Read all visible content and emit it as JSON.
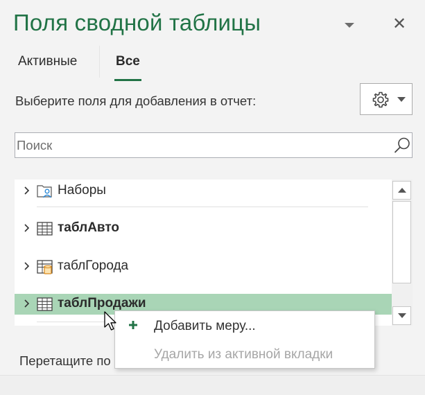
{
  "header": {
    "title": "Поля сводной таблицы",
    "close_glyph": "✕"
  },
  "tabs": [
    {
      "label": "Активные",
      "selected": false
    },
    {
      "label": "Все",
      "selected": true
    }
  ],
  "instruction": "Выберите поля для добавления в отчет:",
  "settings": {
    "icon": "gear-icon"
  },
  "search": {
    "placeholder": "Поиск",
    "value": ""
  },
  "fields": [
    {
      "label": "Наборы",
      "icon": "folder-user-icon",
      "bold": false
    },
    {
      "label": "таблАвто",
      "icon": "table-icon",
      "bold": true
    },
    {
      "label": "таблГорода",
      "icon": "table-db-icon",
      "bold": false
    },
    {
      "label": "таблПродажи",
      "icon": "table-icon",
      "bold": true,
      "highlighted": true
    }
  ],
  "context_menu": {
    "items": [
      {
        "label": "Добавить меру...",
        "enabled": true,
        "icon": "plus-icon"
      },
      {
        "label": "Удалить из активной вкладки",
        "enabled": false
      }
    ]
  },
  "drag_hint": "Перетащите по",
  "colors": {
    "accent": "#217346",
    "highlight": "#a9d5b6",
    "disabled_text": "#a6a6a6"
  }
}
